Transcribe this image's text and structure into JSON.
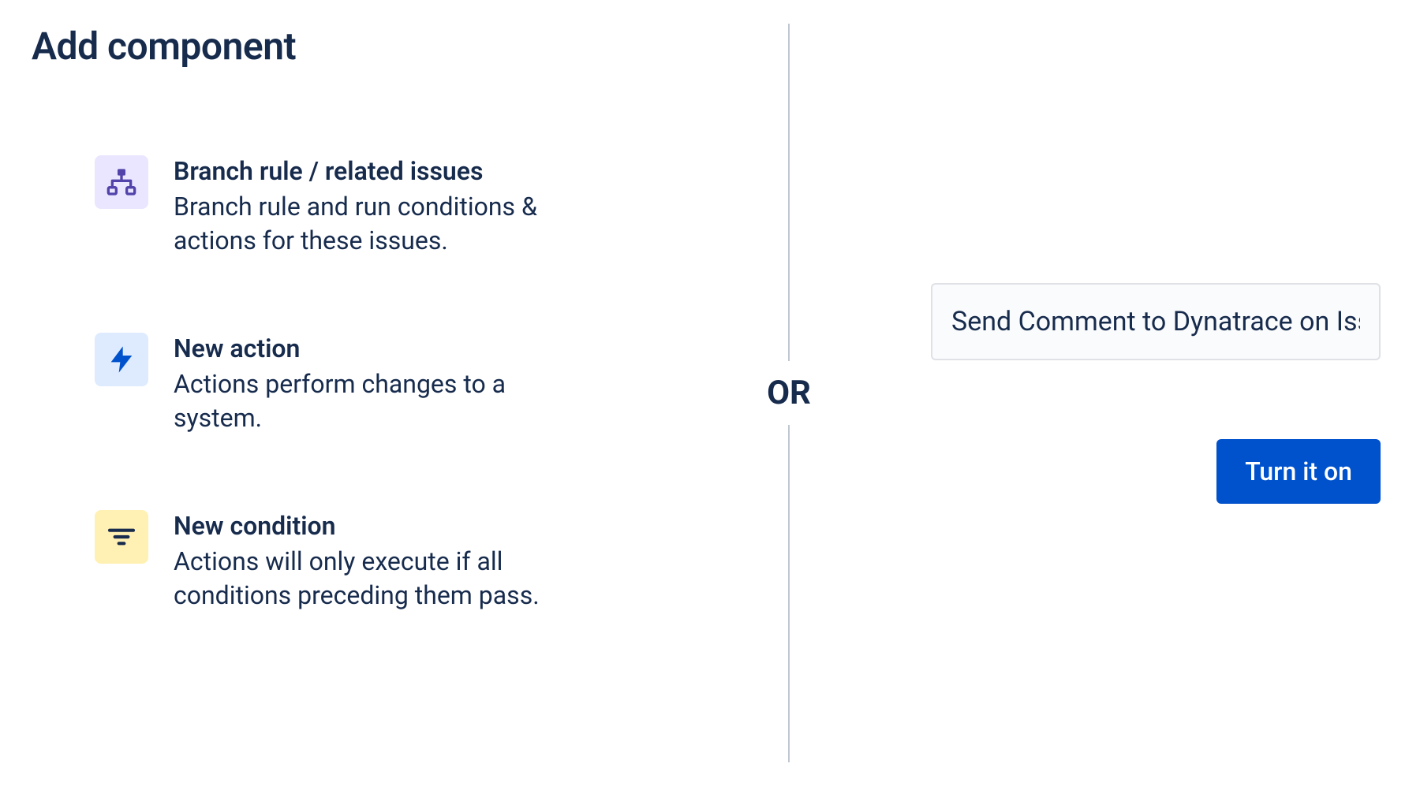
{
  "page": {
    "title": "Add component",
    "divider_label": "OR"
  },
  "options": [
    {
      "key": "branch",
      "title": "Branch rule / related issues",
      "description": "Branch rule and run conditions & actions for these issues."
    },
    {
      "key": "action",
      "title": "New action",
      "description": "Actions perform changes to a system."
    },
    {
      "key": "condition",
      "title": "New condition",
      "description": "Actions will only execute if all conditions preceding them pass."
    }
  ],
  "right": {
    "name_value": "Send Comment to Dynatrace on Issu",
    "turn_on_label": "Turn it on"
  }
}
